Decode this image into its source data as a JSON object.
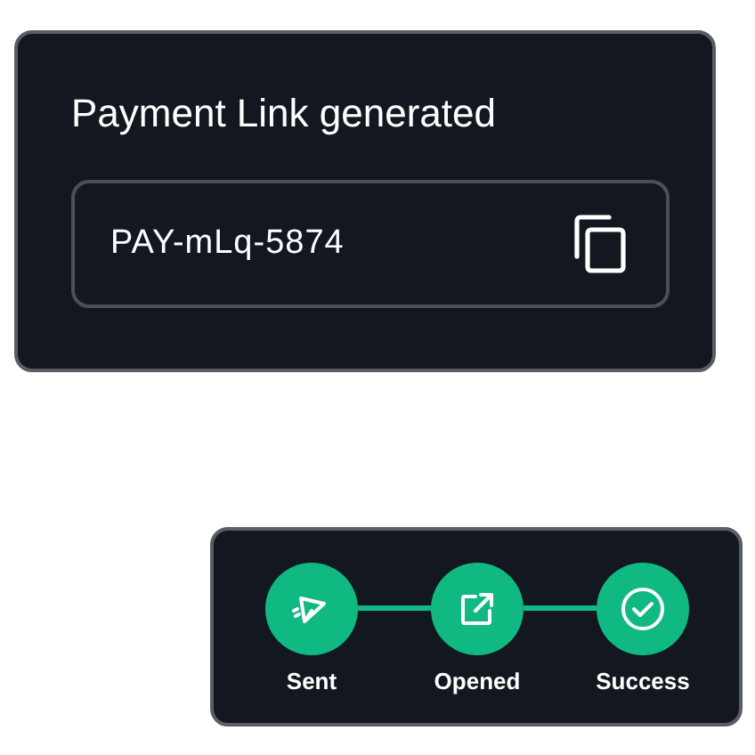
{
  "payment_link": {
    "title": "Payment Link generated",
    "value": "PAY-mLq-5874"
  },
  "progress": {
    "steps": [
      {
        "kind": "sent",
        "label": "Sent",
        "done": true
      },
      {
        "kind": "opened",
        "label": "Opened",
        "done": true
      },
      {
        "kind": "success",
        "label": "Success",
        "done": true
      }
    ]
  }
}
